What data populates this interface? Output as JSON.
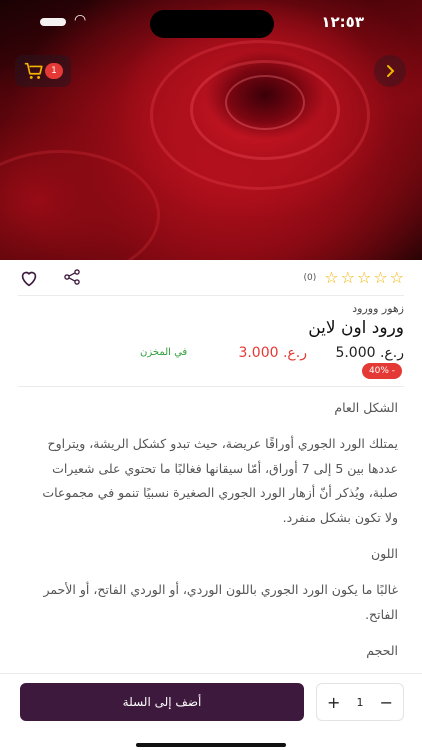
{
  "status_bar": {
    "time": "١٢:٥٣"
  },
  "header": {
    "cart_count": "1"
  },
  "product": {
    "rating_count": "(0)",
    "category": "زهور وورود",
    "title": "ورود اون لاين",
    "price_new": "ر.ع. 5.000",
    "price_old": "ر.ع. 3.000",
    "stock_status": "في المخزن",
    "discount_badge": "40% -"
  },
  "description": {
    "sections": [
      {
        "heading": "الشكل العام",
        "text": "يمتلك الورد الجوري أوراقًا عريضة، حيث تبدو كشكل الريشة، ويتراوح عددها بين 5 إلى 7 أوراق، أمّا سيقانها فغالبًا ما تحتوي على شعيرات صلبة، ويُذكر أنّ أزهار الورد الجوري الصغيرة نسبيًا تنمو في مجموعات ولا تكون بشكل منفرد."
      },
      {
        "heading": "اللون",
        "text": "غالبًا ما يكون الورد الجوري باللون الوردي، أو الوردي الفاتح، أو الأحمر الفاتح."
      },
      {
        "heading": "الحجم",
        "text": ""
      }
    ]
  },
  "bottom_bar": {
    "add_to_cart_label": "أضف إلى السلة",
    "quantity": "1",
    "plus_label": "+",
    "minus_label": "−"
  },
  "colors": {
    "primary": "#3d1a3d",
    "accent_red": "#e53935",
    "star": "#f4b400",
    "in_stock": "#2e9d3a"
  }
}
